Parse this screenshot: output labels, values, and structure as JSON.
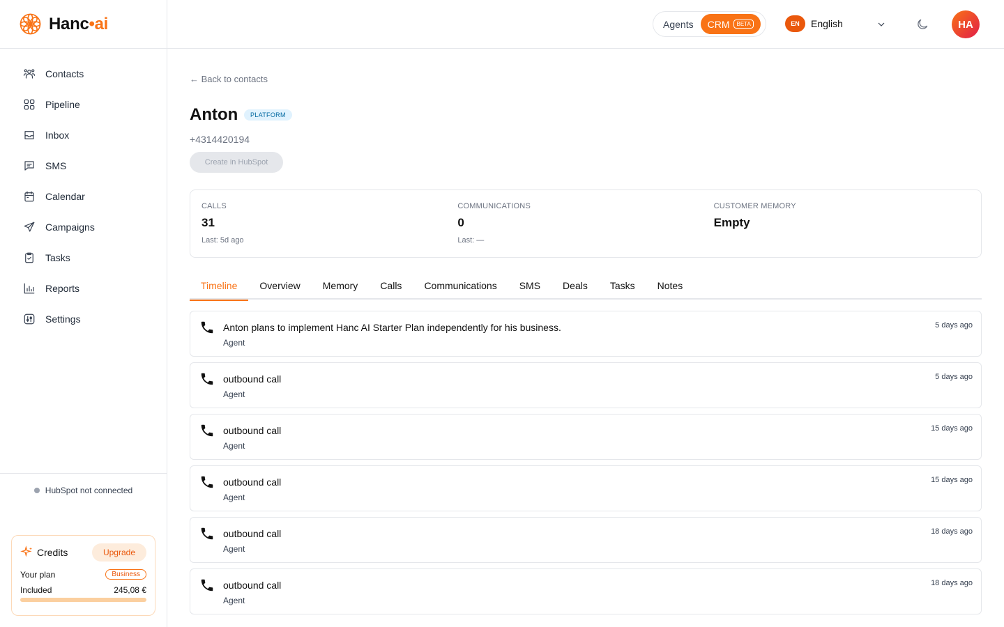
{
  "brand": {
    "name_main": "Hanc",
    "name_dot": "•",
    "name_ai": "ai",
    "color": "#f97316"
  },
  "sidebar": {
    "items": [
      {
        "label": "Contacts",
        "icon": "contacts-icon"
      },
      {
        "label": "Pipeline",
        "icon": "pipeline-icon"
      },
      {
        "label": "Inbox",
        "icon": "inbox-icon"
      },
      {
        "label": "SMS",
        "icon": "sms-icon"
      },
      {
        "label": "Calendar",
        "icon": "calendar-icon"
      },
      {
        "label": "Campaigns",
        "icon": "send-icon"
      },
      {
        "label": "Tasks",
        "icon": "clipboard-icon"
      },
      {
        "label": "Reports",
        "icon": "chart-icon"
      },
      {
        "label": "Settings",
        "icon": "settings-icon"
      }
    ],
    "hubspot_status": "HubSpot not connected",
    "credits": {
      "title": "Credits",
      "upgrade": "Upgrade",
      "plan_label": "Your plan",
      "plan_value": "Business",
      "included_label": "Included",
      "included_value": "245,08 €",
      "progress": 1.0
    }
  },
  "header": {
    "mode_agents": "Agents",
    "mode_crm": "CRM",
    "beta": "BETA",
    "lang_code": "EN",
    "lang_label": "English",
    "avatar_initials": "HA"
  },
  "contact": {
    "back": "← Back to contacts",
    "name": "Anton",
    "badge": "PLATFORM",
    "phone": "+4314420194",
    "create_button": "Create in HubSpot"
  },
  "stats": [
    {
      "label": "CALLS",
      "value": "31",
      "sub": "Last: 5d ago"
    },
    {
      "label": "COMMUNICATIONS",
      "value": "0",
      "sub": "Last: —"
    },
    {
      "label": "CUSTOMER MEMORY",
      "value": "Empty",
      "sub": ""
    }
  ],
  "tabs": [
    "Timeline",
    "Overview",
    "Memory",
    "Calls",
    "Communications",
    "SMS",
    "Deals",
    "Tasks",
    "Notes"
  ],
  "active_tab": "Timeline",
  "timeline": [
    {
      "title": "Anton plans to implement Hanc AI Starter Plan independently for his business.",
      "sub": "Agent",
      "time": "5 days ago"
    },
    {
      "title": "outbound call",
      "sub": "Agent",
      "time": "5 days ago"
    },
    {
      "title": "outbound call",
      "sub": "Agent",
      "time": "15 days ago"
    },
    {
      "title": "outbound call",
      "sub": "Agent",
      "time": "15 days ago"
    },
    {
      "title": "outbound call",
      "sub": "Agent",
      "time": "18 days ago"
    },
    {
      "title": "outbound call",
      "sub": "Agent",
      "time": "18 days ago"
    }
  ]
}
